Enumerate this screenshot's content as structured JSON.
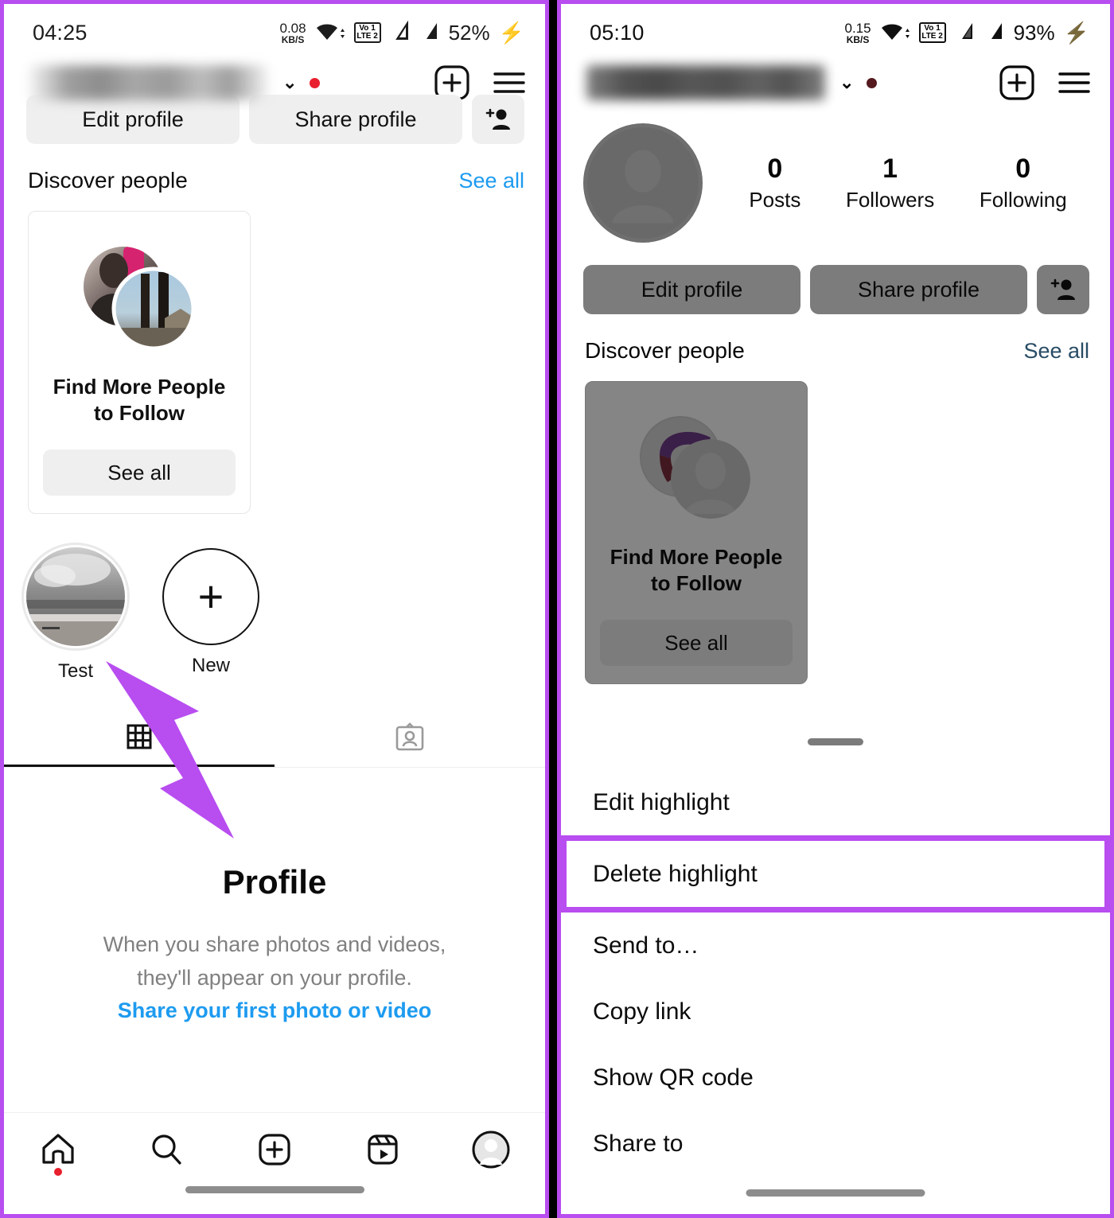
{
  "meta": {
    "accent_purple": "#b84df0",
    "link_blue": "#1d9bf0",
    "notification_red": "#e81f2d"
  },
  "left_phone": {
    "status_bar": {
      "time": "04:25",
      "net_speed_value": "0.08",
      "net_speed_unit": "KB/S",
      "volte_top": "Vo 1",
      "volte_bottom": "LTE 2",
      "battery": "52%"
    },
    "app_bar": {
      "username_redacted": "",
      "chevron": "⌄"
    },
    "actions": {
      "edit_profile": "Edit profile",
      "share_profile": "Share profile"
    },
    "discover": {
      "title": "Discover people",
      "see_all": "See all",
      "card": {
        "name_line1": "Find More People",
        "name_line2": "to Follow",
        "see_all_button": "See all"
      }
    },
    "highlights": [
      {
        "label": "Test"
      },
      {
        "label": "New"
      }
    ],
    "empty_state": {
      "title": "Profile",
      "line1": "When you share photos and videos,",
      "line2": "they'll appear on your profile.",
      "link": "Share your first photo or video"
    },
    "bottom_nav": [
      {
        "name": "home",
        "active": true
      },
      {
        "name": "search",
        "active": false
      },
      {
        "name": "create",
        "active": false
      },
      {
        "name": "reels",
        "active": false
      },
      {
        "name": "profile",
        "active": false
      }
    ]
  },
  "right_phone": {
    "status_bar": {
      "time": "05:10",
      "net_speed_value": "0.15",
      "net_speed_unit": "KB/S",
      "volte_top": "Vo 1",
      "volte_bottom": "LTE 2",
      "battery": "93%"
    },
    "app_bar": {
      "username_redacted": "",
      "chevron": "⌄"
    },
    "stats": [
      {
        "num": "0",
        "label": "Posts"
      },
      {
        "num": "1",
        "label": "Followers"
      },
      {
        "num": "0",
        "label": "Following"
      }
    ],
    "actions": {
      "edit_profile": "Edit profile",
      "share_profile": "Share profile"
    },
    "discover": {
      "title": "Discover people",
      "see_all": "See all",
      "card": {
        "name_line1": "Find More People",
        "name_line2": "to Follow",
        "see_all_button": "See all"
      }
    },
    "sheet": {
      "items": [
        {
          "label": "Edit highlight",
          "highlighted": false
        },
        {
          "label": "Delete highlight",
          "highlighted": true
        },
        {
          "label": "Send to…",
          "highlighted": false
        },
        {
          "label": "Copy link",
          "highlighted": false
        },
        {
          "label": "Show QR code",
          "highlighted": false
        },
        {
          "label": "Share to",
          "highlighted": false
        }
      ]
    }
  }
}
